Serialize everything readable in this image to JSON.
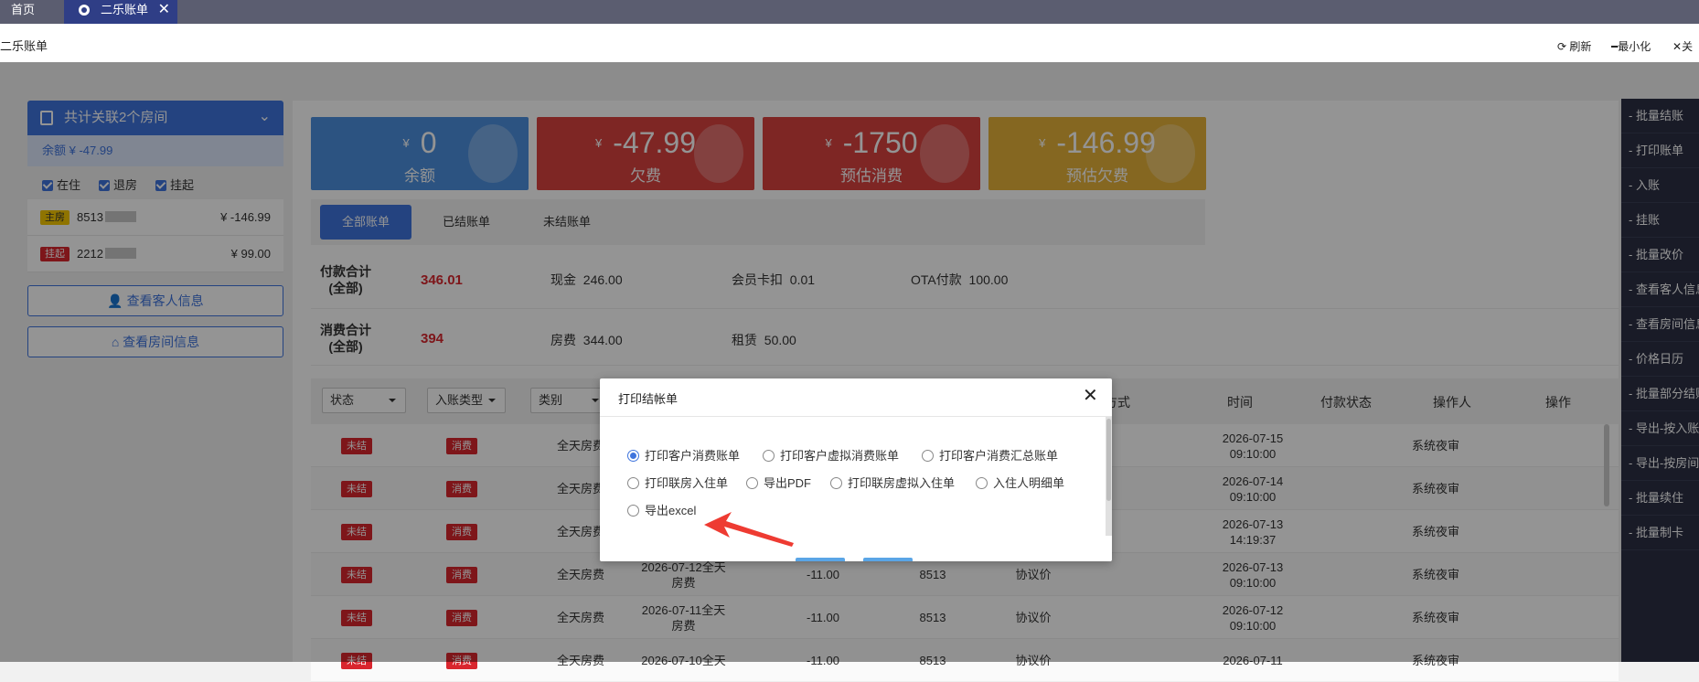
{
  "tabs": [
    {
      "label": "首页"
    },
    {
      "label": "二乐账单"
    }
  ],
  "titlebar": {
    "title": "二乐账单",
    "refresh": "刷新",
    "minimize": "最小化",
    "close": "关"
  },
  "left_panel": {
    "header": "共计关联2个房间",
    "balance": "余额 ¥ -47.99",
    "filters": [
      "在住",
      "退房",
      "挂起"
    ],
    "rooms": [
      {
        "tag": "主房",
        "number": "8513",
        "amount": "¥ -146.99"
      },
      {
        "tag": "挂起",
        "number": "2212",
        "amount": "¥ 99.00"
      }
    ],
    "btn_guest": "查看客人信息",
    "btn_room": "查看房间信息"
  },
  "stats": [
    {
      "value": "0",
      "label": "余额",
      "color": "#4c8fde"
    },
    {
      "value": "-47.99",
      "label": "欠费",
      "color": "#d9423e"
    },
    {
      "value": "-1750",
      "label": "预估消费",
      "color": "#d9423e"
    },
    {
      "value": "-146.99",
      "label": "预估欠费",
      "color": "#e6b23a"
    }
  ],
  "currency": "¥",
  "filter_tabs": [
    "全部账单",
    "已结账单",
    "未结账单"
  ],
  "payment_summary": {
    "label_1": "付款合计",
    "label_2": "(全部)",
    "total": "346.01",
    "items": [
      {
        "name": "现金",
        "value": "246.00"
      },
      {
        "name": "会员卡扣",
        "value": "0.01"
      },
      {
        "name": "OTA付款",
        "value": "100.00"
      }
    ]
  },
  "consume_summary": {
    "label_1": "消费合计",
    "label_2": "(全部)",
    "total": "394",
    "items": [
      {
        "name": "房费",
        "value": "344.00"
      },
      {
        "name": "租赁",
        "value": "50.00"
      }
    ]
  },
  "table": {
    "dropdowns": [
      "状态",
      "入账类型",
      "类别"
    ],
    "headers": [
      "支付方式",
      "时间",
      "付款状态",
      "操作人",
      "操作"
    ],
    "rows": [
      {
        "status": "未结",
        "type": "消费",
        "category": "全天房费",
        "desc": "",
        "amount": "",
        "room": "",
        "pay": "",
        "time1": "2026-07-15",
        "time2": "09:10:00",
        "operator": "系统夜审"
      },
      {
        "status": "未结",
        "type": "消费",
        "category": "全天房费",
        "desc": "",
        "amount": "",
        "room": "",
        "pay": "",
        "time1": "2026-07-14",
        "time2": "09:10:00",
        "operator": "系统夜审"
      },
      {
        "status": "未结",
        "type": "消费",
        "category": "全天房费",
        "desc": "",
        "amount": "",
        "room": "",
        "pay": "",
        "time1": "2026-07-13",
        "time2": "14:19:37",
        "operator": "系统夜审"
      },
      {
        "status": "未结",
        "type": "消费",
        "category": "全天房费",
        "desc": "2026-07-12全天\n房费",
        "amount": "-11.00",
        "room": "8513",
        "pay": "协议价",
        "time1": "2026-07-13",
        "time2": "09:10:00",
        "operator": "系统夜审"
      },
      {
        "status": "未结",
        "type": "消费",
        "category": "全天房费",
        "desc": "2026-07-11全天\n房费",
        "amount": "-11.00",
        "room": "8513",
        "pay": "协议价",
        "time1": "2026-07-12",
        "time2": "09:10:00",
        "operator": "系统夜审"
      },
      {
        "status": "未结",
        "type": "消费",
        "category": "全天房费",
        "desc": "2026-07-10全天",
        "amount": "-11.00",
        "room": "8513",
        "pay": "协议价",
        "time1": "2026-07-11",
        "time2": "",
        "operator": "系统夜审"
      }
    ]
  },
  "right_bar": [
    "- 批量结账",
    "- 打印账单",
    "- 入账",
    "- 挂账",
    "- 批量改价",
    "- 查看客人信息",
    "- 查看房间信息",
    "- 价格日历",
    "- 批量部分结账",
    "- 导出-按入账",
    "- 导出-按房间",
    "- 批量续住",
    "- 批量制卡"
  ],
  "modal": {
    "title": "打印结帐单",
    "options": [
      {
        "label": "打印客户消费账单",
        "checked": true
      },
      {
        "label": "打印客户虚拟消费账单",
        "checked": false
      },
      {
        "label": "打印客户消费汇总账单",
        "checked": false
      },
      {
        "label": "打印联房入住单",
        "checked": false
      },
      {
        "label": "导出PDF",
        "checked": false
      },
      {
        "label": "打印联房虚拟入住单",
        "checked": false
      },
      {
        "label": "入住人明细单",
        "checked": false
      },
      {
        "label": "导出excel",
        "checked": false
      }
    ]
  }
}
